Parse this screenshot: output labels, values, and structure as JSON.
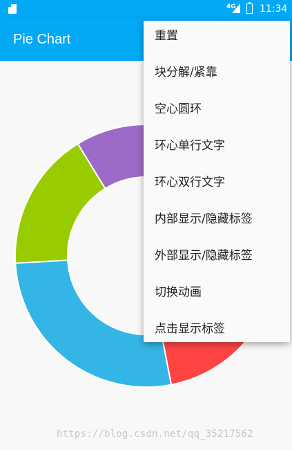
{
  "status_bar": {
    "network": "4G",
    "time": "11:34"
  },
  "app_bar": {
    "title": "Pie Chart"
  },
  "chart_data": {
    "type": "pie",
    "hole": true,
    "slices": [
      {
        "color": "#4caf50",
        "value": 0
      },
      {
        "color": "#9c6ac7",
        "value": 9
      },
      {
        "color": "#ff4444",
        "value": 30
      },
      {
        "color": "#33b5e5",
        "value": 19
      },
      {
        "color": "#99cc00",
        "value": 12
      }
    ]
  },
  "menu": {
    "items": [
      "重置",
      "块分解/紧靠",
      "空心圆环",
      "环心单行文字",
      "环心双行文字",
      "内部显示/隐藏标签",
      "外部显示/隐藏标签",
      "切换动画",
      "点击显示标签"
    ]
  },
  "watermark": "https://blog.csdn.net/qq_35217562"
}
